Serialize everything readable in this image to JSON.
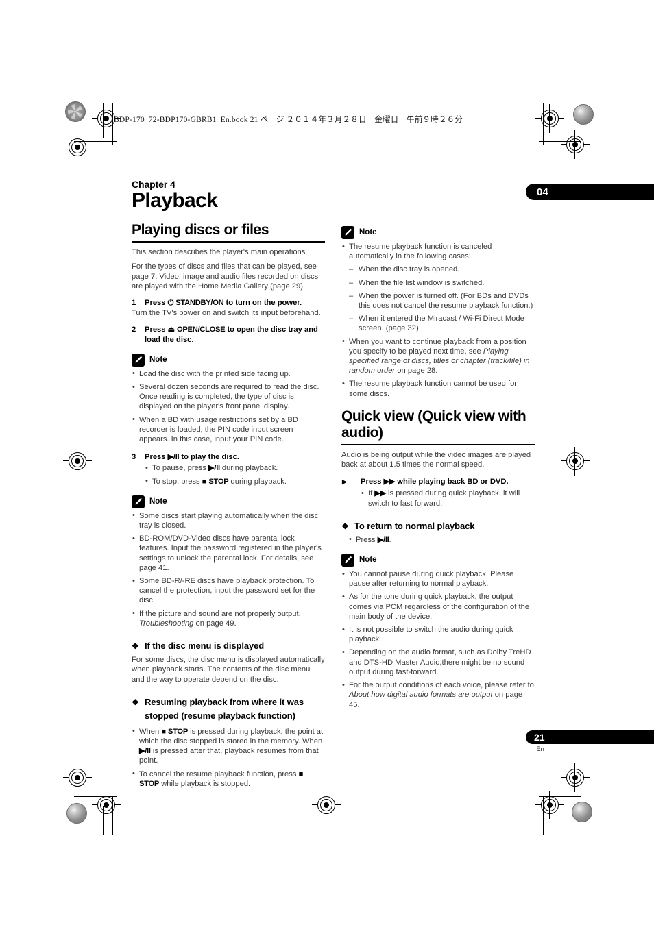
{
  "print_header": "BDP-170_72-BDP170-GBRB1_En.book  21 ページ  ２０１４年３月２８日　金曜日　午前９時２６分",
  "chapter_tab": "04",
  "page_tab": {
    "number": "21",
    "lang": "En"
  },
  "left_column": {
    "chapter_label": "Chapter 4",
    "title": "Playback",
    "section_heading": "Playing discs or files",
    "intro_1": "This section describes the player's main operations.",
    "intro_2": "For the types of discs and files that can be played, see page 7. Video, image and audio files recorded on discs are played with the Home Media Gallery (page 29).",
    "step1_num": "1",
    "step1_text": "Press ⏻ STANDBY/ON to turn on the power.",
    "step1_sub": "Turn the TV's power on and switch its input beforehand.",
    "step2_num": "2",
    "step2_text": "Press ⏏ OPEN/CLOSE to open the disc tray and load the disc.",
    "note1_title": "Note",
    "note1_items": [
      "Load the disc with the printed side facing up.",
      "Several dozen seconds are required to read the disc. Once reading is completed, the type of disc is displayed on the player's front panel display.",
      "When a BD with usage restrictions set by a BD recorder is loaded, the PIN code input screen appears. In this case, input your PIN code."
    ],
    "step3_num": "3",
    "step3_text": "Press ▶/II to play the disc.",
    "step3_bullets": [
      "To pause, press ▶/II during playback.",
      "To stop, press ■ STOP during playback."
    ],
    "note2_title": "Note",
    "note2_items": [
      "Some discs start playing automatically when the disc tray is closed.",
      "BD-ROM/DVD-Video discs have parental lock features. Input the password registered in the player's settings to unlock the parental lock. For details, see page 41.",
      "Some BD-R/-RE discs have playback protection. To cancel the protection, input the password set for the disc.",
      "If the picture and sound are not properly output, Troubleshooting on page 49."
    ],
    "sub1_heading": "If the disc menu is displayed",
    "sub1_body": "For some discs, the disc menu is displayed automatically when playback starts. The contents of the disc menu and the way to operate depend on the disc.",
    "sub2_heading": "Resuming playback from where it was stopped (resume playback function)",
    "sub2_bullets": [
      "When ■ STOP is pressed during playback, the point at which the disc stopped is stored in the memory. When ▶/II is pressed after that, playback resumes from that point.",
      "To cancel the resume playback function, press ■ STOP while playback is stopped."
    ]
  },
  "right_column": {
    "note3_title": "Note",
    "note3_lead": "The resume playback function is canceled automatically in the following cases:",
    "note3_dashes": [
      "When the disc tray is opened.",
      "When the file list window is switched.",
      "When the power is turned off. (For BDs and DVDs this does not cancel the resume playback function.)",
      "When it entered the Miracast / Wi-Fi Direct Mode screen. (page 32)"
    ],
    "note3_items": [
      "When you want to continue playback from a position you specify to be played next time, see Playing specified range of discs, titles or chapter (track/file) in random order on page 28.",
      "The resume playback function cannot be used for some discs."
    ],
    "section_heading": "Quick view (Quick view with audio)",
    "intro": "Audio is being output while the video images are played back at about 1.5 times the normal speed.",
    "step_text": "Press ▶▶ while playing back BD or DVD.",
    "step_bullet": "If ▶▶ is pressed during quick playback, it will switch to fast forward.",
    "sub_heading": "To return to normal playback",
    "sub_bullet": "Press ▶/II.",
    "note4_title": "Note",
    "note4_items": [
      "You cannot pause during quick playback. Please pause after returning to normal playback.",
      "As for the tone during quick playback, the output comes via PCM regardless of the configuration of the main body of the device.",
      "It is not possible to switch the audio during quick playback.",
      "Depending on the audio format, such as Dolby TreHD and DTS-HD Master Audio,there might be no sound output during fast-forward.",
      "For the output conditions of each voice, please refer to About how digital audio formats are output on page 45."
    ]
  }
}
